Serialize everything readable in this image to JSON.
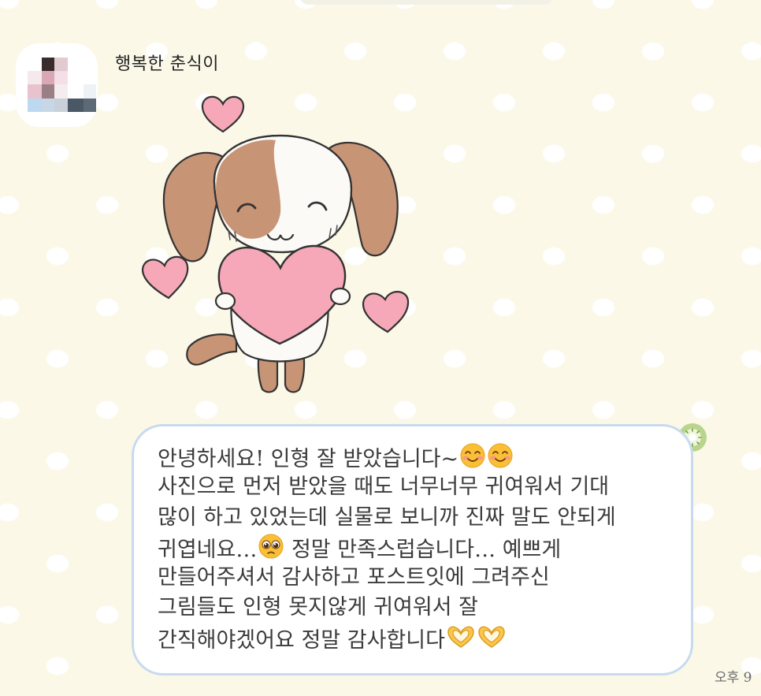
{
  "chat": {
    "sender_name": "행복한 춘식이",
    "message_lines": [
      "안녕하세요! 인형 잘 받았습니다~",
      "사진으로 먼저 받았을 때도 너무너무 귀여워서 기대",
      "많이 하고 있었는데 실물로 보니까 진짜 말도 안되게",
      "귀엽네요…",
      "정말 만족스럽습니다… 예쁘게",
      "만들어주셔서 감사하고 포스트잇에 그려주신",
      "그림들도 인형 못지않게 귀여워서 잘",
      "간직해야겠어요 정말 감사합니다"
    ],
    "timestamp": "오후 9",
    "emojis": {
      "smile": "smiling-face-icon",
      "pleading": "pleading-face-icon",
      "heart_hands": "heart-hands-icon"
    },
    "colors": {
      "background": "#fbf8e8",
      "bubble_border": "#c7daf0",
      "bubble_fill": "#ffffff"
    }
  },
  "sticker": {
    "name": "puppy-holding-heart-sticker",
    "palette": [
      "#c79476",
      "#fbfaf6",
      "#f6a8b8"
    ]
  }
}
